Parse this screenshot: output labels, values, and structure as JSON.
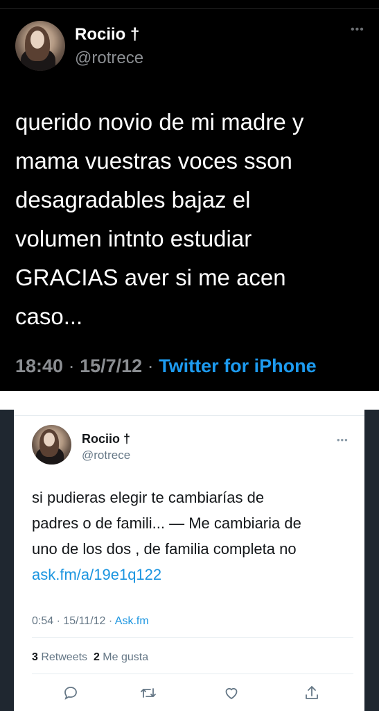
{
  "tweet1": {
    "name": "Rociio †",
    "handle": "@rotrece",
    "more": "•••",
    "lines": [
      "querido novio de mi madre y",
      "mama vuestras voces sson",
      "desagradables bajaz el",
      "volumen intnto estudiar",
      "GRACIAS aver si me acen",
      "caso..."
    ],
    "time": "18:40",
    "sep1": " · ",
    "date": "15/7/12",
    "sep2": " · ",
    "source": "Twitter for iPhone"
  },
  "tweet2": {
    "name": "Rociio †",
    "handle": "@rotrece",
    "more": "•••",
    "lines": [
      "si pudieras elegir te cambiarías de",
      "padres o de famili... — Me cambiaria de",
      "uno de los dos , de familia completa no"
    ],
    "link": "ask.fm/a/19e1q122",
    "time": "0:54",
    "sep1": " · ",
    "date": "15/11/12",
    "sep2": " · ",
    "source": "Ask.fm",
    "retweets_count": "3",
    "retweets_label": " Retweets",
    "likes_count": "2",
    "likes_label": " Me gusta",
    "actions": [
      "reply-icon",
      "retweet-icon",
      "like-icon",
      "share-icon"
    ]
  }
}
